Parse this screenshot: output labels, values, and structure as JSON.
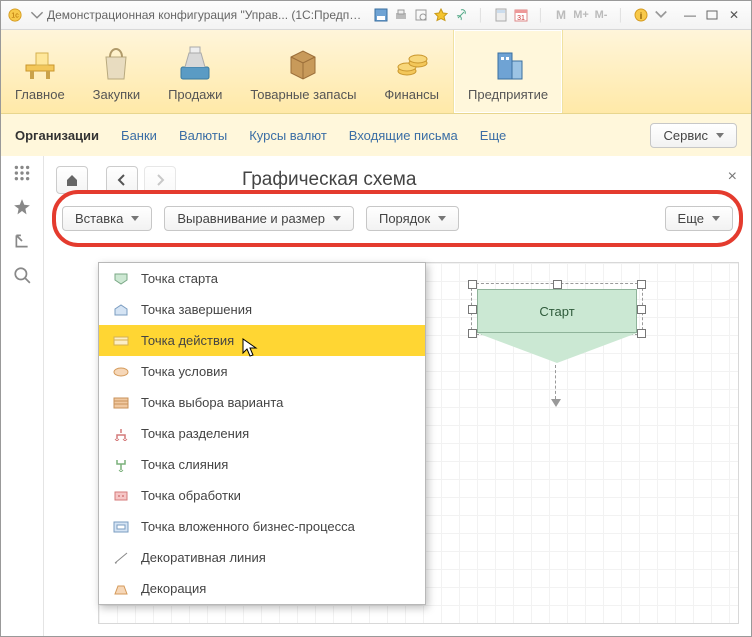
{
  "title": "Демонстрационная конфигурация \"Управ... (1С:Предприятие)",
  "mainTabs": {
    "t0": "Главное",
    "t1": "Закупки",
    "t2": "Продажи",
    "t3": "Товарные запасы",
    "t4": "Финансы",
    "t5": "Предприятие"
  },
  "subbar": {
    "s0": "Организации",
    "s1": "Банки",
    "s2": "Валюты",
    "s3": "Курсы валют",
    "s4": "Входящие письма",
    "more": "Еще",
    "service": "Сервис"
  },
  "page": {
    "title": "Графическая схема"
  },
  "toolbar": {
    "insert": "Вставка",
    "align": "Выравнивание и размер",
    "order": "Порядок",
    "more": "Еще"
  },
  "insertMenu": {
    "i0": "Точка старта",
    "i1": "Точка завершения",
    "i2": "Точка действия",
    "i3": "Точка условия",
    "i4": "Точка выбора варианта",
    "i5": "Точка разделения",
    "i6": "Точка слияния",
    "i7": "Точка обработки",
    "i8": "Точка вложенного бизнес-процесса",
    "i9": "Декоративная линия",
    "i10": "Декорация"
  },
  "canvas": {
    "startLabel": "Старт"
  }
}
